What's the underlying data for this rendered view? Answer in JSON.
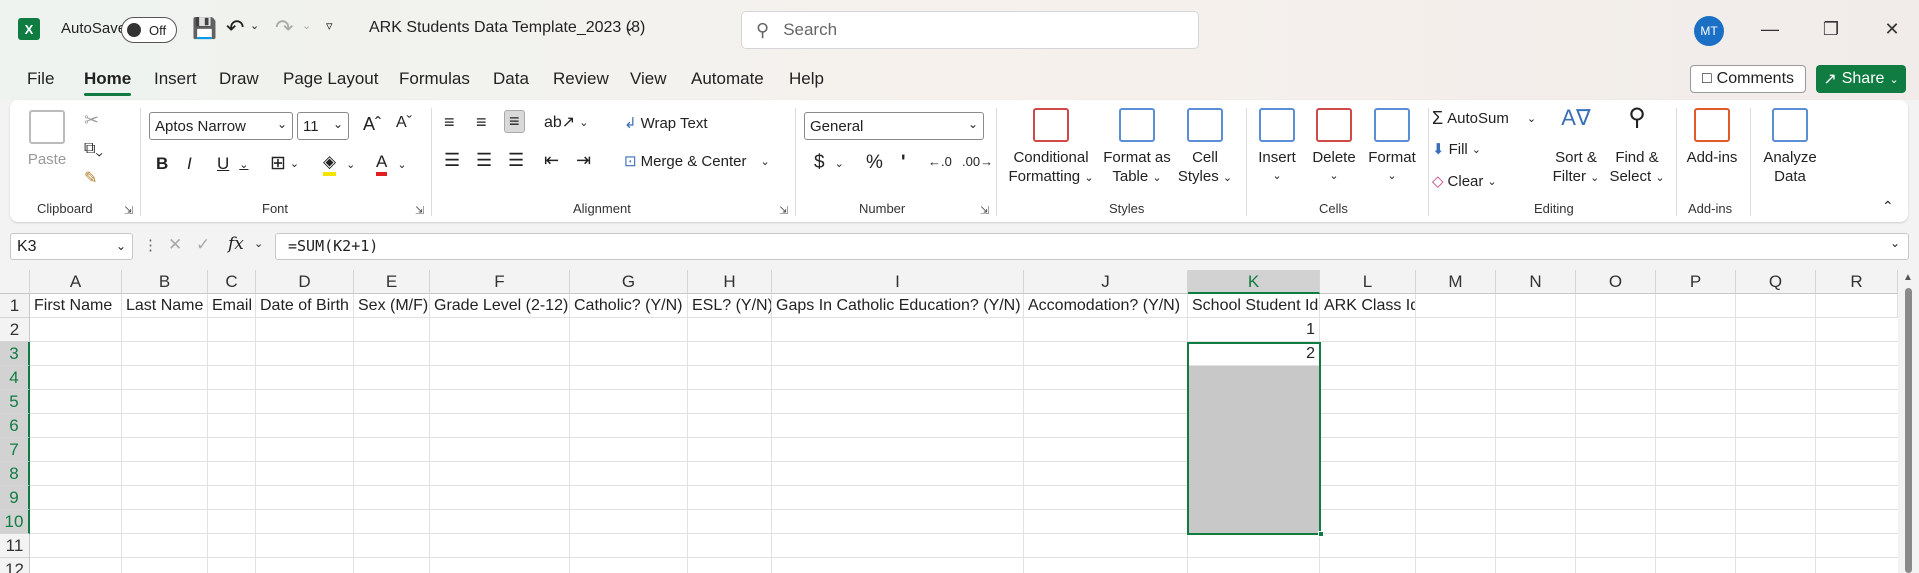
{
  "titlebar": {
    "app_logo": "X",
    "autosave_label": "AutoSave",
    "autosave_state": "Off",
    "doc_title": "ARK Students Data Template_2023 (8)",
    "search_placeholder": "Search",
    "avatar_initials": "MT"
  },
  "menu": {
    "items": [
      "File",
      "Home",
      "Insert",
      "Draw",
      "Page Layout",
      "Formulas",
      "Data",
      "Review",
      "View",
      "Automate",
      "Help"
    ],
    "comments_label": "Comments",
    "share_label": "Share"
  },
  "ribbon": {
    "clipboard": {
      "paste": "Paste",
      "label": "Clipboard"
    },
    "font": {
      "name": "Aptos Narrow",
      "size": "11",
      "label": "Font"
    },
    "alignment": {
      "wrap": "Wrap Text",
      "merge": "Merge & Center",
      "label": "Alignment"
    },
    "number": {
      "format": "General",
      "label": "Number"
    },
    "styles": {
      "conditional": "Conditional",
      "conditional2": "Formatting",
      "format_table": "Format as",
      "format_table2": "Table",
      "cell_styles": "Cell",
      "cell_styles2": "Styles",
      "label": "Styles"
    },
    "cells": {
      "insert": "Insert",
      "delete": "Delete",
      "format": "Format",
      "label": "Cells"
    },
    "editing": {
      "autosum": "AutoSum",
      "fill": "Fill",
      "clear": "Clear",
      "sort": "Sort &",
      "sort2": "Filter",
      "find": "Find &",
      "find2": "Select",
      "label": "Editing"
    },
    "addins": {
      "addins": "Add-ins",
      "label": "Add-ins",
      "analyze": "Analyze",
      "analyze2": "Data"
    }
  },
  "formula_bar": {
    "name_box": "K3",
    "formula": "=SUM(K2+1)"
  },
  "sheet": {
    "columns": [
      "A",
      "B",
      "C",
      "D",
      "E",
      "F",
      "G",
      "H",
      "I",
      "J",
      "K",
      "L",
      "M",
      "N",
      "O",
      "P",
      "Q",
      "R"
    ],
    "rows": [
      "1",
      "2",
      "3",
      "4",
      "5",
      "6",
      "7",
      "8",
      "9",
      "10",
      "11",
      "12"
    ],
    "headers": [
      "First Name",
      "Last Name",
      "Email",
      "Date of Birth",
      "Sex (M/F)",
      "Grade Level (2-12)",
      "Catholic? (Y/N)",
      "ESL? (Y/N)",
      "Gaps In Catholic Education? (Y/N)",
      "Accomodation? (Y/N)",
      "School Student Id",
      "ARK Class Id"
    ],
    "k2": "1",
    "k3": "2",
    "active_cell": "K3"
  },
  "colors": {
    "accent": "#107c41",
    "selection_shade": "#c8c8c8"
  }
}
